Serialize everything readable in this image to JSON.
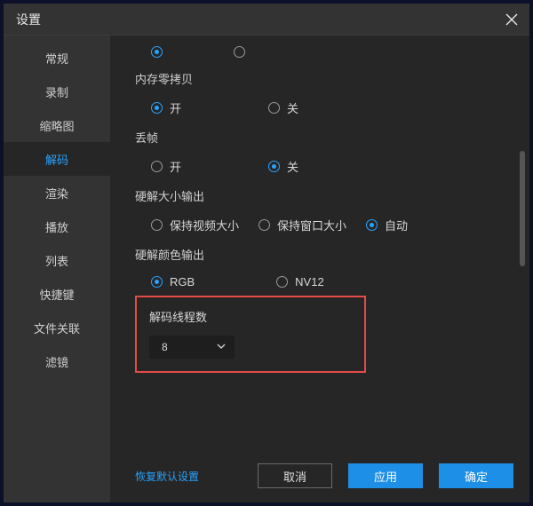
{
  "dialog": {
    "title": "设置"
  },
  "sidebar": {
    "items": [
      {
        "label": "常规"
      },
      {
        "label": "录制"
      },
      {
        "label": "缩略图"
      },
      {
        "label": "解码"
      },
      {
        "label": "渲染"
      },
      {
        "label": "播放"
      },
      {
        "label": "列表"
      },
      {
        "label": "快捷键"
      },
      {
        "label": "文件关联"
      },
      {
        "label": "滤镜"
      }
    ],
    "active_index": 3
  },
  "sections": {
    "zero_copy": {
      "title": "内存零拷贝",
      "options": [
        "开",
        "关"
      ],
      "selected": 0
    },
    "drop_frame": {
      "title": "丢帧",
      "options": [
        "开",
        "关"
      ],
      "selected": 1
    },
    "size_output": {
      "title": "硬解大小输出",
      "options": [
        "保持视频大小",
        "保持窗口大小",
        "自动"
      ],
      "selected": 2
    },
    "color_output": {
      "title": "硬解颜色输出",
      "options": [
        "RGB",
        "NV12"
      ],
      "selected": 0
    },
    "threads": {
      "title": "解码线程数",
      "value": "8"
    }
  },
  "footer": {
    "restore": "恢复默认设置",
    "cancel": "取消",
    "apply": "应用",
    "ok": "确定"
  }
}
